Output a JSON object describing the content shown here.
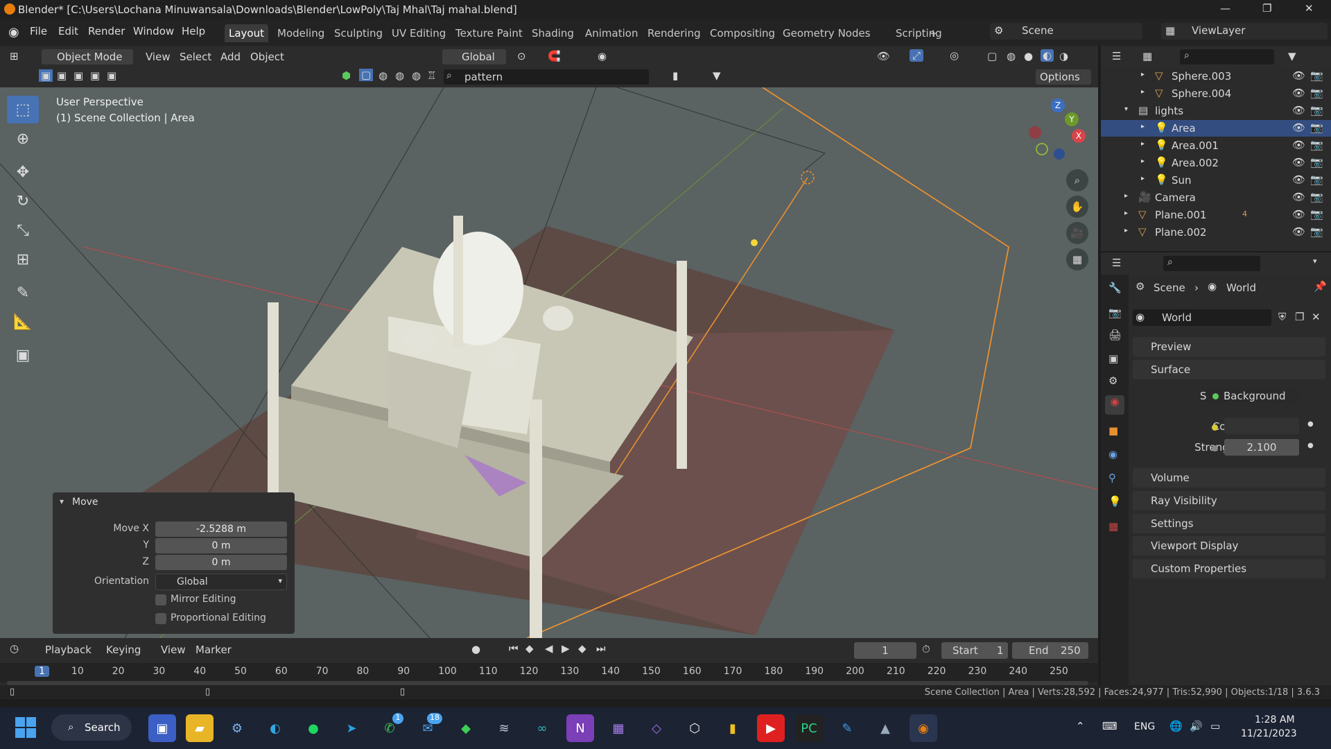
{
  "window": {
    "title": "Blender* [C:\\Users\\Lochana Minuwansala\\Downloads\\Blender\\LowPoly\\Taj Mhal\\Taj mahal.blend]",
    "minimize": "—",
    "maximize": "❐",
    "close": "✕"
  },
  "menu": [
    "File",
    "Edit",
    "Render",
    "Window",
    "Help"
  ],
  "workspaces": [
    "Layout",
    "Modeling",
    "Sculpting",
    "UV Editing",
    "Texture Paint",
    "Shading",
    "Animation",
    "Rendering",
    "Compositing",
    "Geometry Nodes",
    "Scripting",
    "+"
  ],
  "scene": {
    "name": "Scene",
    "view_layer": "ViewLayer"
  },
  "viewport_header": {
    "mode": "Object Mode",
    "menus": [
      "View",
      "Select",
      "Add",
      "Object"
    ],
    "orientation": "Global",
    "search": "pattern",
    "options": "Options"
  },
  "viewport": {
    "perspective": "User Perspective",
    "collection": "(1) Scene Collection | Area",
    "gizmo": {
      "x": "X",
      "y": "Y",
      "z": "Z"
    }
  },
  "move_panel": {
    "title": "Move",
    "move_x_label": "Move X",
    "move_x": "-2.5288 m",
    "y_label": "Y",
    "y": "0 m",
    "z_label": "Z",
    "z": "0 m",
    "orientation_label": "Orientation",
    "orientation": "Global",
    "mirror": "Mirror Editing",
    "proportional": "Proportional Editing"
  },
  "outliner": {
    "items": [
      {
        "name": "Sphere.003",
        "level": 2,
        "icon": "mesh-icon",
        "color": "#e0a050"
      },
      {
        "name": "Sphere.004",
        "level": 2,
        "icon": "mesh-icon",
        "color": "#e0a050"
      },
      {
        "name": "lights",
        "level": 1,
        "icon": "collection-icon",
        "color": "#cfcfcf"
      },
      {
        "name": "Area",
        "level": 2,
        "icon": "light-icon",
        "color": "#e0a050",
        "selected": true
      },
      {
        "name": "Area.001",
        "level": 2,
        "icon": "light-icon",
        "color": "#e0a050"
      },
      {
        "name": "Area.002",
        "level": 2,
        "icon": "light-icon",
        "color": "#e0a050"
      },
      {
        "name": "Sun",
        "level": 2,
        "icon": "light-icon",
        "color": "#e0a050"
      },
      {
        "name": "Camera",
        "level": 1,
        "icon": "camera-icon",
        "color": "#e0a050"
      },
      {
        "name": "Plane.001",
        "level": 1,
        "icon": "mesh-icon",
        "color": "#e0a050",
        "extra": "4"
      },
      {
        "name": "Plane.002",
        "level": 1,
        "icon": "mesh-icon",
        "color": "#e0a050"
      }
    ]
  },
  "properties": {
    "breadcrumb_scene": "Scene",
    "breadcrumb_world": "World",
    "world_name": "World",
    "preview": "Preview",
    "surface_panel": "Surface",
    "surface_label": "Surface",
    "surface_value": "Background",
    "color_label": "Color",
    "strength_label": "Strength",
    "strength_value": "2.100",
    "panels": [
      "Volume",
      "Ray Visibility",
      "Settings",
      "Viewport Display",
      "Custom Properties"
    ]
  },
  "timeline": {
    "menus": [
      "Playback",
      "Keying",
      "View",
      "Marker"
    ],
    "current_frame": "1",
    "start_label": "Start",
    "start": "1",
    "end_label": "End",
    "end": "250",
    "ticks": [
      "1",
      "10",
      "20",
      "30",
      "40",
      "50",
      "60",
      "70",
      "80",
      "90",
      "100",
      "110",
      "120",
      "130",
      "140",
      "150",
      "160",
      "170",
      "180",
      "190",
      "200",
      "210",
      "220",
      "230",
      "240",
      "250"
    ]
  },
  "status": {
    "info": "Scene Collection | Area | Verts:28,592 | Faces:24,977 | Tris:52,990 | Objects:1/18 | 3.6.3"
  },
  "taskbar": {
    "search": "Search",
    "lang": "ENG",
    "time": "1:28 AM",
    "date": "11/21/2023",
    "badge_whatsapp": "1",
    "badge_mail": "18"
  }
}
